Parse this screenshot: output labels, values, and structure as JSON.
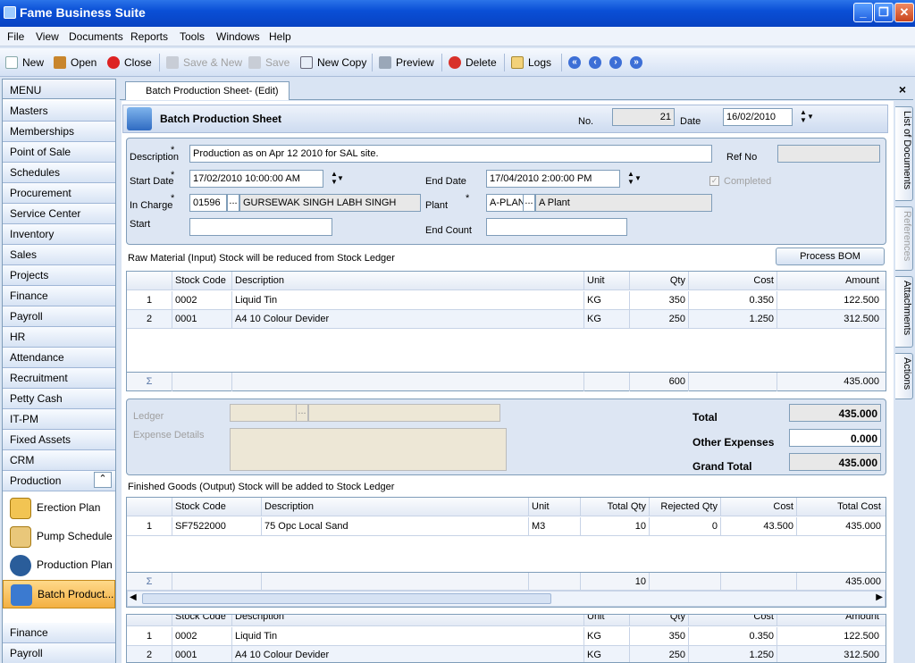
{
  "app": {
    "title": "Fame Business Suite",
    "win_min": "_",
    "win_max": "❐",
    "win_close": "✕"
  },
  "menu": [
    "File",
    "View",
    "Documents",
    "Reports",
    "Tools",
    "Windows",
    "Help"
  ],
  "toolbar": {
    "new": "New",
    "open": "Open",
    "close": "Close",
    "save_new": "Save & New",
    "save": "Save",
    "new_copy": "New Copy",
    "preview": "Preview",
    "delete": "Delete",
    "logs": "Logs"
  },
  "sidebar": {
    "header": "MENU",
    "items": [
      "Masters",
      "Memberships",
      "Point of Sale",
      "Schedules",
      "Procurement",
      "Service Center",
      "Inventory",
      "Sales",
      "Projects",
      "Finance",
      "Payroll",
      "HR",
      "Attendance",
      "Recruitment",
      "Petty Cash",
      "IT-PM",
      "Fixed Assets",
      "CRM",
      "Production"
    ],
    "production_collapse": "⌃",
    "sub": [
      "Erection Plan",
      "Pump Schedule",
      "Production Plan",
      "Batch Product..."
    ],
    "bottom": [
      "Finance",
      "Payroll"
    ]
  },
  "doc": {
    "tab": "Batch Production Sheet- (Edit)",
    "close": "×",
    "title": "Batch Production Sheet",
    "no_label": "No.",
    "no_value": "21",
    "date_label": "Date",
    "date_value": "16/02/2010"
  },
  "form": {
    "description_label": "Description",
    "description_value": "Production as on Apr 12 2010 for SAL site.",
    "refno_label": "Ref No",
    "refno_value": "",
    "start_date_label": "Start Date",
    "start_date_value": "17/02/2010 10:00:00 AM",
    "end_date_label": "End Date",
    "end_date_value": "17/04/2010   2:00:00 PM",
    "completed_label": "Completed",
    "in_charge_label": "In Charge",
    "in_charge_code": "01596",
    "in_charge_name": "GURSEWAK SINGH   LABH SINGH",
    "plant_label": "Plant",
    "plant_code": "A-PLANT",
    "plant_name": "A Plant",
    "start_label": "Start",
    "start_value": "",
    "end_count_label": "End Count",
    "end_count_value": "",
    "required": "*",
    "ellipsis": "..."
  },
  "raw": {
    "caption": "Raw Material (Input) Stock will be reduced from Stock Ledger",
    "process_bom": "Process BOM",
    "columns": [
      "Stock Code",
      "Description",
      "Unit",
      "Qty",
      "Cost",
      "Amount"
    ],
    "rows": [
      {
        "no": "1",
        "code": "0002",
        "desc": "Liquid Tin",
        "unit": "KG",
        "qty": "350",
        "cost": "0.350",
        "amount": "122.500"
      },
      {
        "no": "2",
        "code": "0001",
        "desc": "A4 10 Colour Devider",
        "unit": "KG",
        "qty": "250",
        "cost": "1.250",
        "amount": "312.500"
      }
    ],
    "sigma": "Σ",
    "total_qty": "600",
    "total_amount": "435.000"
  },
  "totals": {
    "ledger_label": "Ledger",
    "expense_label": "Expense Details",
    "total_label": "Total",
    "total_value": "435.000",
    "other_label": "Other Expenses",
    "other_value": "0.000",
    "grand_label": "Grand Total",
    "grand_value": "435.000"
  },
  "finished": {
    "caption": "Finished Goods (Output) Stock will be added to Stock Ledger",
    "columns": [
      "Stock Code",
      "Description",
      "Unit",
      "Total Qty",
      "Rejected Qty",
      "Cost",
      "Total Cost"
    ],
    "rows": [
      {
        "no": "1",
        "code": "SF7522000",
        "desc": "75 Opc Local Sand",
        "unit": "M3",
        "total_qty": "10",
        "rejected": "0",
        "cost": "43.500",
        "total_cost": "435.000"
      }
    ],
    "sigma": "Σ",
    "sum_qty": "10",
    "sum_cost": "435.000"
  },
  "lower": {
    "columns": [
      "Stock Code",
      "Description",
      "Unit",
      "Qty",
      "Cost",
      "Amount"
    ],
    "rows": [
      {
        "no": "1",
        "code": "0002",
        "desc": "Liquid Tin",
        "unit": "KG",
        "qty": "350",
        "cost": "0.350",
        "amount": "122.500"
      },
      {
        "no": "2",
        "code": "0001",
        "desc": "A4 10 Colour Devider",
        "unit": "KG",
        "qty": "250",
        "cost": "1.250",
        "amount": "312.500"
      }
    ]
  },
  "right_tabs": [
    "List of Documents",
    "References",
    "Attachments",
    "Actions"
  ]
}
